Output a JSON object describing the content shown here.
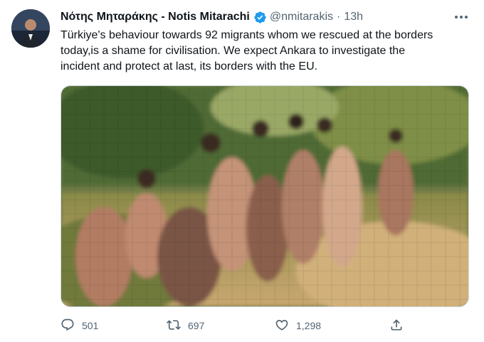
{
  "tweet": {
    "author_name": "Νότης Μηταράκης - Notis Mitarachi",
    "handle": "@nmitarakis",
    "separator": "·",
    "time": "13h",
    "text_lines": [
      "Türkiye's behaviour towards 92 migrants whom we rescued at the borders",
      "today,is a shame for civilisation. We expect Ankara to investigate the",
      "incident and protect at last, its borders with the EU."
    ]
  },
  "actions": {
    "replies": "501",
    "retweets": "697",
    "likes": "1,298"
  },
  "icons": {
    "verified": "verified-badge-icon",
    "more": "more-options-icon",
    "reply": "reply-icon",
    "retweet": "retweet-icon",
    "like": "heart-icon",
    "share": "share-icon"
  },
  "colors": {
    "verified": "#1d9bf0",
    "secondary_text": "#536471",
    "primary_text": "#0f1419"
  }
}
